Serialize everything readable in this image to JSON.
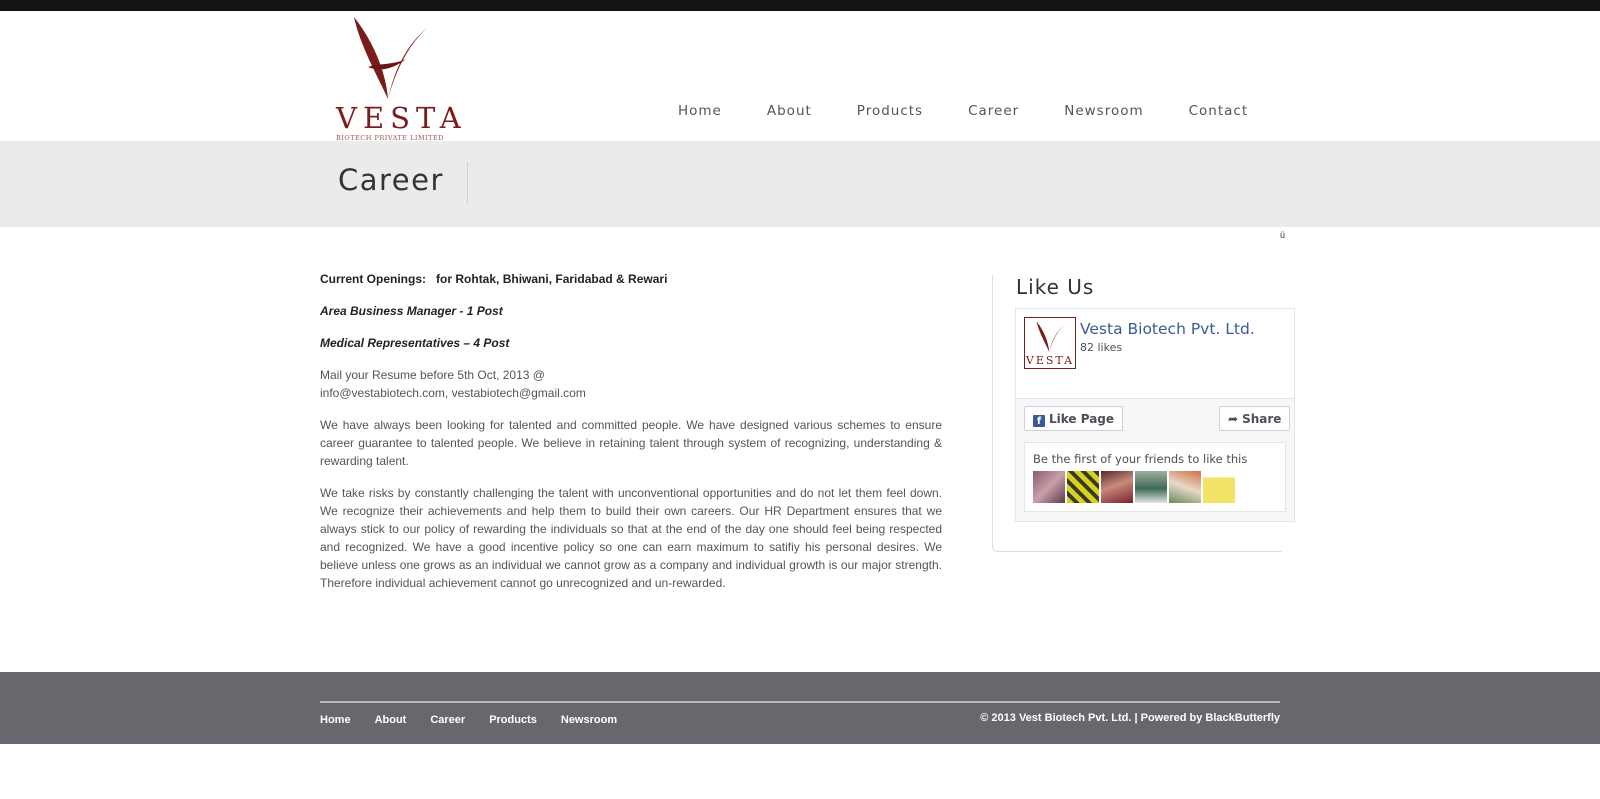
{
  "brand": {
    "name": "VESTA",
    "tagline": "BIOTECH PRIVATE LIMITED",
    "accent": "#7a1c1c"
  },
  "nav": [
    "Home",
    "About",
    "Products",
    "Career",
    "Newsroom",
    "Contact"
  ],
  "page_title": "Career",
  "content": {
    "openings_label": "Current Openings:",
    "openings_locations": "for Rohtak, Bhiwani, Faridabad & Rewari",
    "post1": "Area Business Manager  -  1 Post",
    "post2": "Medical Representatives – 4 Post",
    "mail_line1": "Mail your Resume before 5th Oct, 2013 @",
    "mail_line2": "info@vestabiotech.com, vestabiotech@gmail.com",
    "para1": "We have always been looking for talented and committed people. We have designed various schemes to ensure career guarantee to talented people. We believe in retaining talent through system of recognizing, understanding & rewarding talent.",
    "para2": "We take risks by constantly challenging the talent with unconventional opportunities and do not let them feel down. We recognize their achievements and help them to build their own careers. Our HR Department ensures that we always stick to our policy of rewarding the individuals so that at the end of the day one should feel being respected and recognized. We have a good incentive policy so one can earn maximum to satifiy his personal desires. We believe unless one grows as an individual we cannot grow as a company and individual growth is our major strength. Therefore individual achievement cannot go unrecognized and un-rewarded."
  },
  "sidebar": {
    "title": "Like Us",
    "fb": {
      "page_name": "Vesta Biotech Pvt. Ltd.",
      "likes": "82 likes",
      "like_button": "Like Page",
      "share_button": "Share",
      "friends_text": "Be the first of your friends to like this",
      "thumb_text": "VESTA",
      "facebook_color": "#3b5998"
    }
  },
  "footer": {
    "links": [
      "Home",
      "About",
      "Career",
      "Products",
      "Newsroom"
    ],
    "copyright": "© 2013 Vest Biotech Pvt. Ltd. | Powered by",
    "powered_by": "BlackButterfly"
  }
}
